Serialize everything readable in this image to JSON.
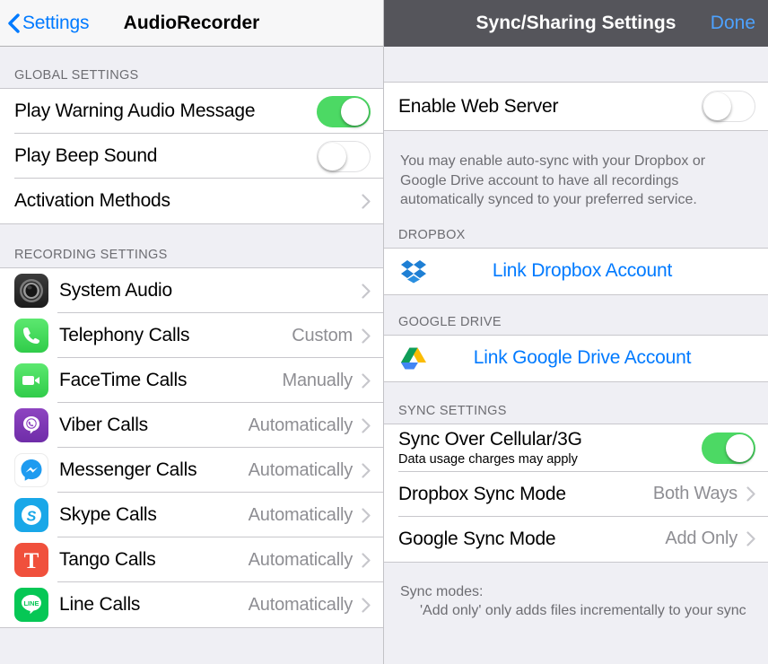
{
  "left_pane": {
    "navbar": {
      "back_label": "Settings",
      "back_icon": "chevron-left-icon",
      "title": "AudioRecorder"
    },
    "sections": [
      {
        "header": "GLOBAL SETTINGS",
        "rows": [
          {
            "title": "Play Warning Audio Message",
            "control": "toggle",
            "state": "on"
          },
          {
            "title": "Play Beep Sound",
            "control": "toggle",
            "state": "off"
          },
          {
            "title": "Activation Methods",
            "control": "chevron",
            "value": ""
          }
        ]
      },
      {
        "header": "RECORDING SETTINGS",
        "rows": [
          {
            "title": "System Audio",
            "value": "",
            "icon": "system-audio-icon"
          },
          {
            "title": "Telephony Calls",
            "value": "Custom",
            "icon": "phone-icon"
          },
          {
            "title": "FaceTime Calls",
            "value": "Manually",
            "icon": "facetime-icon"
          },
          {
            "title": "Viber Calls",
            "value": "Automatically",
            "icon": "viber-icon"
          },
          {
            "title": "Messenger Calls",
            "value": "Automatically",
            "icon": "messenger-icon"
          },
          {
            "title": "Skype Calls",
            "value": "Automatically",
            "icon": "skype-icon"
          },
          {
            "title": "Tango Calls",
            "value": "Automatically",
            "icon": "tango-icon"
          },
          {
            "title": "Line Calls",
            "value": "Automatically",
            "icon": "line-icon"
          }
        ]
      }
    ]
  },
  "right_pane": {
    "navbar": {
      "title": "Sync/Sharing Settings",
      "done_label": "Done"
    },
    "web_server": {
      "title": "Enable Web Server",
      "state": "off"
    },
    "intro_note": "You may enable auto-sync with your Dropbox or Google Drive account to have all recordings automatically synced to your preferred service.",
    "dropbox": {
      "header": "DROPBOX",
      "link_label": "Link Dropbox Account",
      "icon": "dropbox-icon"
    },
    "google_drive": {
      "header": "GOOGLE DRIVE",
      "link_label": "Link Google Drive Account",
      "icon": "google-drive-icon"
    },
    "sync_settings": {
      "header": "SYNC SETTINGS",
      "cellular": {
        "title": "Sync Over Cellular/3G",
        "subtitle": "Data usage charges may apply",
        "state": "on"
      },
      "dropbox_mode": {
        "title": "Dropbox Sync Mode",
        "value": "Both Ways"
      },
      "google_mode": {
        "title": "Google Sync Mode",
        "value": "Add Only"
      }
    },
    "footer": {
      "line1": "Sync modes:",
      "line2": "'Add only' only adds files incrementally to your sync"
    }
  },
  "colors": {
    "accent_blue": "#007aff",
    "toggle_on_green": "#4cd964",
    "navbar_dark": "#55555b",
    "list_bg": "#efeff4"
  }
}
